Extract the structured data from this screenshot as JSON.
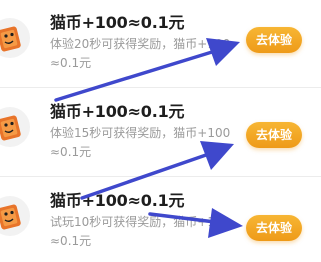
{
  "tasks": [
    {
      "icon": "cat-coin-tile-icon",
      "title": "猫币+100≈0.1元",
      "description": "体验20秒可获得奖励，猫币+100≈0.1元",
      "button_label": "去体验"
    },
    {
      "icon": "cat-coin-tile-icon",
      "title": "猫币+100≈0.1元",
      "description": "体验15秒可获得奖励，猫币+100≈0.1元",
      "button_label": "去体验"
    },
    {
      "icon": "cat-coin-tile-icon",
      "title": "猫币+100≈0.1元",
      "description": "试玩10秒可获得奖励，猫币+100≈0.1元",
      "button_label": "去体验"
    }
  ],
  "colors": {
    "button": "#f0a020",
    "annotation_arrow": "#3f48cc",
    "title_text": "#1e1e1e",
    "description_text": "#9a9a9a"
  },
  "annotations": {
    "arrow_icon": "arrow-icon",
    "arrow_count": 3
  }
}
